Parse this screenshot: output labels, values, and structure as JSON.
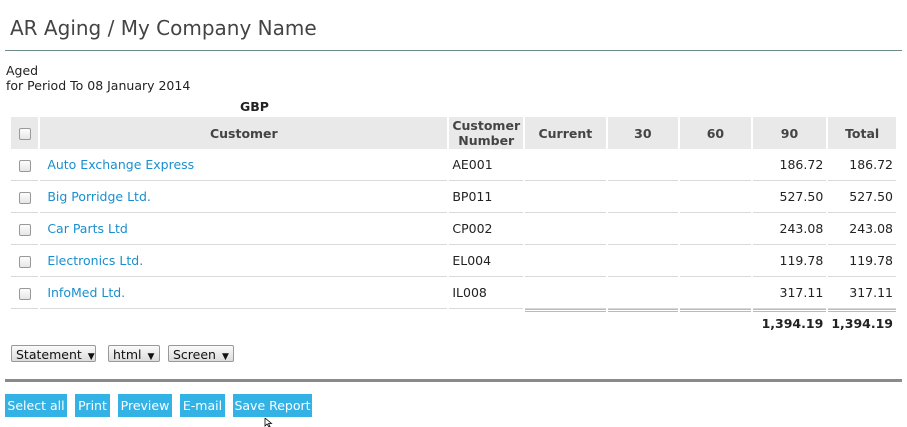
{
  "page": {
    "title": "AR Aging / My Company Name"
  },
  "report": {
    "line1": "Aged",
    "line2": "for Period To 08 January 2014",
    "currency": "GBP"
  },
  "table": {
    "headers": {
      "customer": "Customer",
      "customer_number_line1": "Customer",
      "customer_number_line2": "Number",
      "current": "Current",
      "d30": "30",
      "d60": "60",
      "d90": "90",
      "total": "Total"
    },
    "rows": [
      {
        "customer": "Auto Exchange Express",
        "number": "AE001",
        "current": "",
        "d30": "",
        "d60": "",
        "d90": "186.72",
        "total": "186.72"
      },
      {
        "customer": "Big Porridge Ltd.",
        "number": "BP011",
        "current": "",
        "d30": "",
        "d60": "",
        "d90": "527.50",
        "total": "527.50"
      },
      {
        "customer": "Car Parts Ltd",
        "number": "CP002",
        "current": "",
        "d30": "",
        "d60": "",
        "d90": "243.08",
        "total": "243.08"
      },
      {
        "customer": "Electronics Ltd.",
        "number": "EL004",
        "current": "",
        "d30": "",
        "d60": "",
        "d90": "119.78",
        "total": "119.78"
      },
      {
        "customer": "InfoMed Ltd.",
        "number": "IL008",
        "current": "",
        "d30": "",
        "d60": "",
        "d90": "317.11",
        "total": "317.11"
      }
    ],
    "totals": {
      "current": "",
      "d30": "",
      "d60": "",
      "d90": "1,394.19",
      "total": "1,394.19"
    }
  },
  "controls": {
    "format_select": "Statement",
    "media_select": "html",
    "output_select": "Screen"
  },
  "buttons": {
    "select_all": "Select all",
    "print": "Print",
    "preview": "Preview",
    "email": "E-mail",
    "save_report": "Save Report"
  }
}
